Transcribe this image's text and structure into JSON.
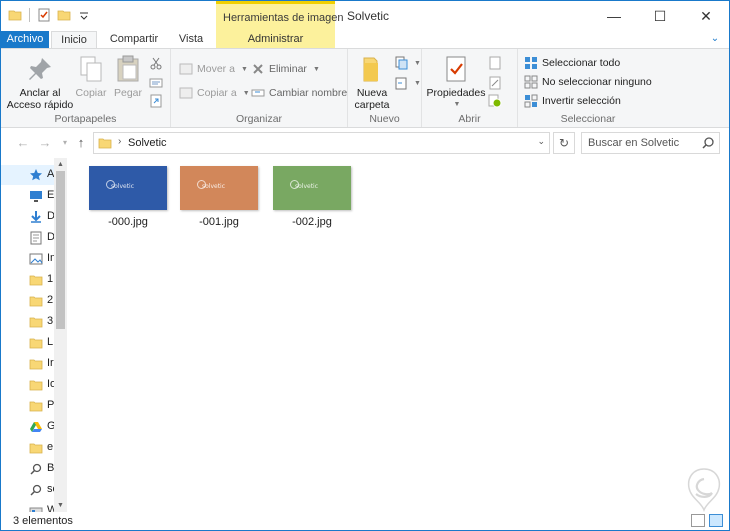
{
  "titlebar": {
    "context_tab_header": "Herramientas de imagen",
    "window_title": "Solvetic",
    "minimize": "—",
    "maximize": "☐",
    "close": "✕"
  },
  "tabs": [
    {
      "label": "Archivo"
    },
    {
      "label": "Inicio"
    },
    {
      "label": "Compartir"
    },
    {
      "label": "Vista"
    },
    {
      "label": "Administrar"
    }
  ],
  "ribbon": {
    "portapapeles": {
      "label": "Portapapeles",
      "pin": "Anclar al Acceso rápido",
      "copy": "Copiar",
      "paste": "Pegar"
    },
    "organizar": {
      "label": "Organizar",
      "move_to": "Mover a",
      "copy_to": "Copiar a",
      "delete": "Eliminar",
      "rename": "Cambiar nombre"
    },
    "nuevo": {
      "label": "Nuevo",
      "new_folder": "Nueva carpeta"
    },
    "abrir": {
      "label": "Abrir",
      "properties": "Propiedades"
    },
    "seleccionar": {
      "label": "Seleccionar",
      "select_all": "Seleccionar todo",
      "select_none": "No seleccionar ninguno",
      "invert": "Invertir selección"
    }
  },
  "address": {
    "path": "Solvetic",
    "search_placeholder": "Buscar en Solvetic"
  },
  "nav_items": [
    {
      "label": "Acceso rápido",
      "icon": "star-icon"
    },
    {
      "label": "Escritorio",
      "icon": "desktop-icon"
    },
    {
      "label": "Descargas",
      "icon": "download-icon"
    },
    {
      "label": "Documentos",
      "icon": "document-icon"
    },
    {
      "label": "Imágenes",
      "icon": "pictures-icon"
    },
    {
      "label": "1",
      "icon": "folder-icon"
    },
    {
      "label": "2",
      "icon": "folder-icon"
    },
    {
      "label": "3",
      "icon": "folder-icon"
    },
    {
      "label": "L",
      "icon": "folder-icon"
    },
    {
      "label": "Ir",
      "icon": "folder-icon"
    },
    {
      "label": "Io",
      "icon": "folder-icon"
    },
    {
      "label": "P",
      "icon": "folder-icon"
    },
    {
      "label": "Google Drive",
      "icon": "google-drive-icon"
    },
    {
      "label": "e",
      "icon": "folder-icon"
    },
    {
      "label": "B",
      "icon": "search-folder-icon"
    },
    {
      "label": "se",
      "icon": "search-folder-icon"
    },
    {
      "label": "W",
      "icon": "drive-icon"
    }
  ],
  "files": [
    {
      "name": "-000.jpg",
      "color": "#2e5aa8",
      "wm": "solvetic"
    },
    {
      "name": "-001.jpg",
      "color": "#d2875a",
      "wm": "solvetic"
    },
    {
      "name": "-002.jpg",
      "color": "#79a862",
      "wm": "solvetic"
    }
  ],
  "status": {
    "count": "3 elementos"
  },
  "colors": {
    "accent": "#1979ca",
    "context_tab": "#fcf19c"
  }
}
